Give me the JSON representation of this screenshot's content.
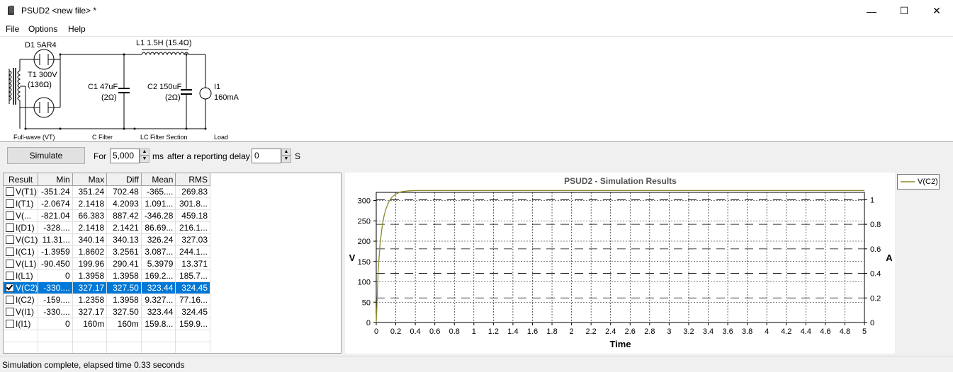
{
  "window": {
    "title": "PSUD2  <new file> *",
    "minimize_glyph": "—",
    "maximize_glyph": "☐",
    "close_glyph": "✕"
  },
  "menu": {
    "items": [
      "File",
      "Options",
      "Help"
    ]
  },
  "schematic": {
    "d1_label": "D1 5AR4",
    "t1_label_line1": "T1 300V",
    "t1_label_line2": "(136Ω)",
    "l1_label": "L1 1.5H (15.4Ω)",
    "c1_label_line1": "C1 47uF",
    "c1_label_line2": "(2Ω)",
    "c2_label_line1": "C2 150uF",
    "c2_label_line2": "(2Ω)",
    "i1_label_line1": "I1",
    "i1_label_line2": "160mA",
    "sections": [
      "Full-wave (VT)",
      "C Filter",
      "LC Filter Section",
      "Load"
    ]
  },
  "toolbar": {
    "simulate_label": "Simulate",
    "for_label": "For",
    "duration_value": "5,000",
    "ms_label": "ms",
    "delay_label": "after a reporting delay of",
    "delay_value": "0",
    "s_label": "S"
  },
  "results": {
    "headers": [
      "Result",
      "Min",
      "Max",
      "Diff",
      "Mean",
      "RMS"
    ],
    "rows": [
      {
        "checked": false,
        "selected": false,
        "result": "V(T1)",
        "min": "-351.24",
        "max": "351.24",
        "diff": "702.48",
        "mean": "-365....",
        "rms": "269.83"
      },
      {
        "checked": false,
        "selected": false,
        "result": "I(T1)",
        "min": "-2.0674",
        "max": "2.1418",
        "diff": "4.2093",
        "mean": "1.091...",
        "rms": "301.8..."
      },
      {
        "checked": false,
        "selected": false,
        "result": "V(...",
        "min": "-821.04",
        "max": "66.383",
        "diff": "887.42",
        "mean": "-346.28",
        "rms": "459.18"
      },
      {
        "checked": false,
        "selected": false,
        "result": "I(D1)",
        "min": "-328....",
        "max": "2.1418",
        "diff": "2.1421",
        "mean": "86.69...",
        "rms": "216.1..."
      },
      {
        "checked": false,
        "selected": false,
        "result": "V(C1)",
        "min": "11.31...",
        "max": "340.14",
        "diff": "340.13",
        "mean": "326.24",
        "rms": "327.03"
      },
      {
        "checked": false,
        "selected": false,
        "result": "I(C1)",
        "min": "-1.3959",
        "max": "1.8602",
        "diff": "3.2561",
        "mean": "3.087...",
        "rms": "244.1..."
      },
      {
        "checked": false,
        "selected": false,
        "result": "V(L1)",
        "min": "-90.450",
        "max": "199.96",
        "diff": "290.41",
        "mean": "5.3979",
        "rms": "13.371"
      },
      {
        "checked": false,
        "selected": false,
        "result": "I(L1)",
        "min": "0",
        "max": "1.3958",
        "diff": "1.3958",
        "mean": "169.2...",
        "rms": "185.7..."
      },
      {
        "checked": true,
        "selected": true,
        "result": "V(C2)",
        "min": "-330....",
        "max": "327.17",
        "diff": "327.50",
        "mean": "323.44",
        "rms": "324.45"
      },
      {
        "checked": false,
        "selected": false,
        "result": "I(C2)",
        "min": "-159....",
        "max": "1.2358",
        "diff": "1.3958",
        "mean": "9.327...",
        "rms": "77.16..."
      },
      {
        "checked": false,
        "selected": false,
        "result": "V(I1)",
        "min": "-330....",
        "max": "327.17",
        "diff": "327.50",
        "mean": "323.44",
        "rms": "324.45"
      },
      {
        "checked": false,
        "selected": false,
        "result": "I(I1)",
        "min": "0",
        "max": "160m",
        "diff": "160m",
        "mean": "159.8...",
        "rms": "159.9..."
      }
    ]
  },
  "chart_data": {
    "type": "line",
    "title": "PSUD2 - Simulation Results",
    "xlabel": "Time",
    "ylabel": "V",
    "y2label": "A",
    "xlim": [
      0,
      5
    ],
    "ylim": [
      0,
      320
    ],
    "y2lim": [
      0,
      1.06
    ],
    "xticks": [
      "0",
      "0.2",
      "0.4",
      "0.6",
      "0.8",
      "1",
      "1.2",
      "1.4",
      "1.6",
      "1.8",
      "2",
      "2.2",
      "2.4",
      "2.6",
      "2.8",
      "3",
      "3.2",
      "3.4",
      "3.6",
      "3.8",
      "4",
      "4.2",
      "4.4",
      "4.6",
      "4.8",
      "5"
    ],
    "yticks": [
      "0",
      "50",
      "100",
      "150",
      "200",
      "250",
      "300"
    ],
    "y2ticks": [
      "0",
      "0.2",
      "0.4",
      "0.6",
      "0.8",
      "1"
    ],
    "grid": true,
    "legend_position": "top-right",
    "series": [
      {
        "name": "V(C2)",
        "color": "#8a8a2a",
        "x": [
          0,
          0.01,
          0.02,
          0.04,
          0.06,
          0.08,
          0.1,
          0.13,
          0.16,
          0.2,
          0.25,
          0.3,
          0.35,
          0.4,
          0.5,
          1,
          2,
          3,
          4,
          5
        ],
        "y": [
          0,
          60,
          130,
          195,
          235,
          262,
          280,
          297,
          308,
          316,
          321,
          323,
          324,
          324.5,
          324.5,
          324.5,
          324.5,
          324.5,
          324.5,
          324.5
        ]
      }
    ]
  },
  "status": {
    "text": "Simulation complete, elapsed time 0.33 seconds"
  }
}
